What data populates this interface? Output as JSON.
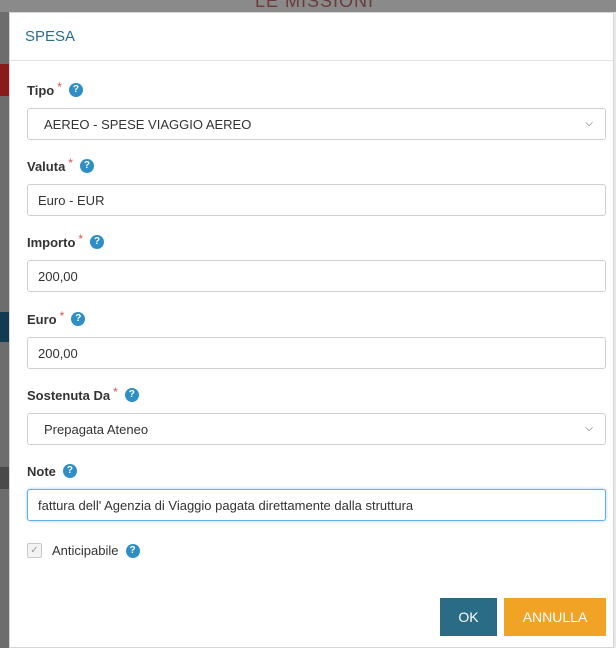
{
  "backdrop": {
    "title": "LE MISSIONI"
  },
  "modal": {
    "title": "SPESA",
    "help_glyph": "?",
    "required_mark": "*",
    "fields": {
      "tipo": {
        "label": "Tipo",
        "value": "AEREO - SPESE VIAGGIO AEREO"
      },
      "valuta": {
        "label": "Valuta",
        "value": "Euro - EUR"
      },
      "importo": {
        "label": "Importo",
        "value": "200,00"
      },
      "euro": {
        "label": "Euro",
        "value": "200,00"
      },
      "sostenuta": {
        "label": "Sostenuta Da",
        "value": "Prepagata Ateneo"
      },
      "note": {
        "label": "Note",
        "value": "fattura dell' Agenzia di Viaggio pagata direttamente dalla struttura"
      }
    },
    "anticipabile": {
      "label": "Anticipabile",
      "checked": true,
      "disabled": true
    },
    "buttons": {
      "ok": "OK",
      "cancel": "ANNULLA"
    }
  },
  "icons": {
    "help": "question-circle-icon",
    "select_arrow": "chevron-down-icon",
    "check": "checkmark-icon"
  },
  "colors": {
    "title": "#2a6d8f",
    "help": "#2e8fc7",
    "required": "#d9534f",
    "ok_button": "#2a6b85",
    "cancel_button": "#f0a324",
    "focus_border": "#66afe9"
  }
}
